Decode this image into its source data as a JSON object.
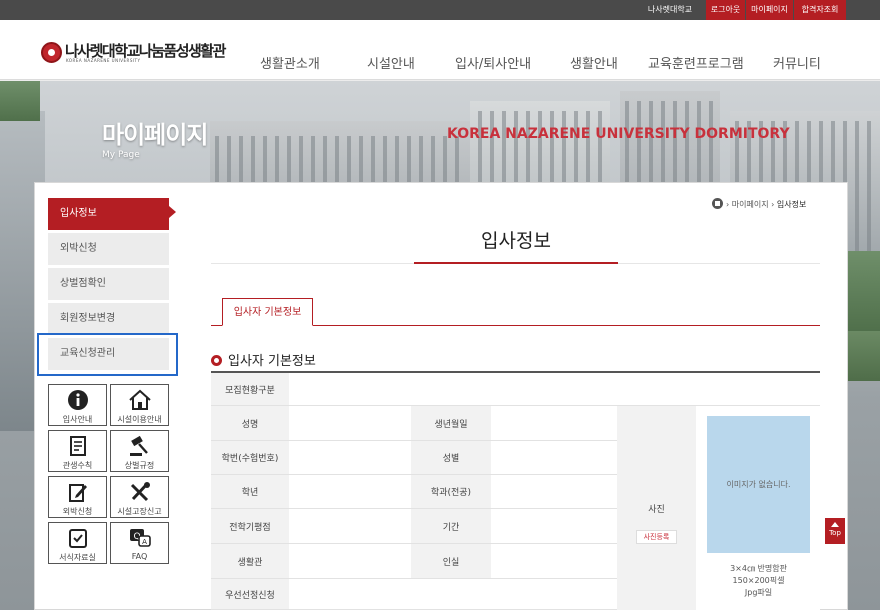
{
  "topbar": {
    "links": [
      "나사렛대학교",
      "로그아웃",
      "마이페이지",
      "합격자조회"
    ]
  },
  "header": {
    "logo_ko": "나사렛대학교나눔품성생활관",
    "logo_en": "KOREA NAZARENE UNIVERSITY",
    "gnb": [
      "생활관소개",
      "시설안내",
      "입사/퇴사안내",
      "생활안내",
      "교육훈련프로그램",
      "커뮤니티"
    ]
  },
  "hero": {
    "title": "마이페이지",
    "subtitle": "My Page",
    "banner": "KOREA NAZARENE UNIVERSITY DORMITORY"
  },
  "sidebar": {
    "items": [
      "입사정보",
      "외박신청",
      "상벌점확인",
      "회원정보변경",
      "교육신청관리"
    ],
    "active_index": 0,
    "quick_links": [
      {
        "label": "입사안내",
        "icon": "info-icon"
      },
      {
        "label": "시설이용안내",
        "icon": "house-icon"
      },
      {
        "label": "관생수칙",
        "icon": "document-icon"
      },
      {
        "label": "상벌규정",
        "icon": "gavel-icon"
      },
      {
        "label": "외박신청",
        "icon": "edit-icon"
      },
      {
        "label": "시설고장신고",
        "icon": "tools-icon"
      },
      {
        "label": "서식자료실",
        "icon": "archive-icon"
      },
      {
        "label": "FAQ",
        "icon": "faq-icon"
      }
    ]
  },
  "breadcrumb": {
    "items": [
      "마이페이지",
      "입사정보"
    ]
  },
  "main": {
    "title": "입사정보",
    "tab": "입사자 기본정보",
    "section_title": "입사자 기본정보",
    "table": {
      "row_label": "모집현황구분",
      "left_labels": [
        "성명",
        "학번(수험번호)",
        "학년",
        "전학기평점",
        "생활관",
        "우선선정신청"
      ],
      "right_labels": [
        "생년월일",
        "성별",
        "학과(전공)",
        "기간",
        "인실"
      ],
      "photo_label": "사진",
      "photo_button": "사진등록",
      "no_image": "이미지가 없습니다.",
      "photo_note": [
        "3×4㎝ 반명함판",
        "150×200픽셀",
        "Jpg파일"
      ]
    }
  },
  "top_button": "Top",
  "colors": {
    "accent": "#b41e23",
    "focus": "#2468c9",
    "photo_placeholder": "#b9d7ec"
  }
}
